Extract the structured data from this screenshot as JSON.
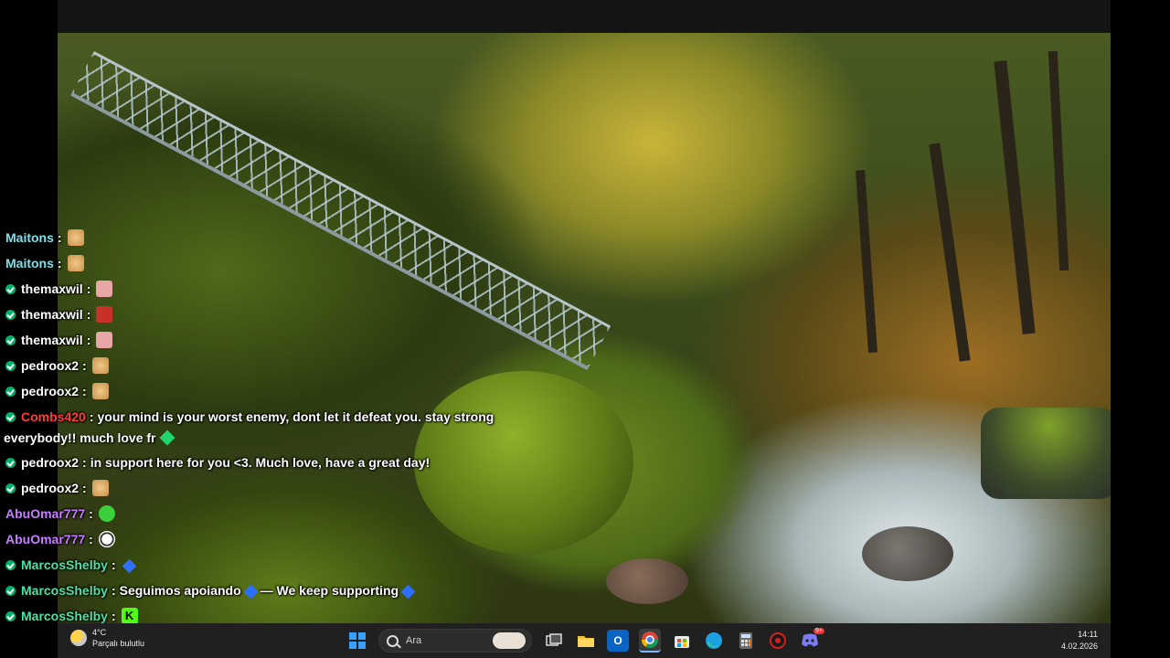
{
  "chat": [
    {
      "user": "Maitons",
      "user_color": "#7fe0e6",
      "badge": false,
      "emote": "clap-icon"
    },
    {
      "user": "Maitons",
      "user_color": "#7fe0e6",
      "badge": false,
      "emote": "clap-icon"
    },
    {
      "user": "themaxwil",
      "user_color": "#ffffff",
      "badge": true,
      "emote": "pink-face-icon"
    },
    {
      "user": "themaxwil",
      "user_color": "#ffffff",
      "badge": true,
      "emote": "red-face-icon"
    },
    {
      "user": "themaxwil",
      "user_color": "#ffffff",
      "badge": true,
      "emote": "pink-face-icon"
    },
    {
      "user": "pedroox2",
      "user_color": "#ffffff",
      "badge": true,
      "emote": "clap-icon"
    },
    {
      "user": "pedroox2",
      "user_color": "#ffffff",
      "badge": true,
      "emote": "clap-icon"
    },
    {
      "user": "Combs420",
      "user_color": "#ff3b3b",
      "badge": true,
      "text": "your mind is your worst enemy, dont let it defeat you. stay strong",
      "text2": "everybody!! much love fr"
    },
    {
      "user": "pedroox2",
      "user_color": "#ffffff",
      "badge": true,
      "text": "in support here for you <3. Much love, have a great day!"
    },
    {
      "user": "pedroox2",
      "user_color": "#ffffff",
      "badge": true,
      "emote": "clap-icon"
    },
    {
      "user": "AbuOmar777",
      "user_color": "#c77dff",
      "badge": false,
      "emote": "green-blob-icon"
    },
    {
      "user": "AbuOmar777",
      "user_color": "#c77dff",
      "badge": false,
      "emote": "soccer-ball-icon"
    },
    {
      "user": "MarcosShelby",
      "user_color": "#4fe0a6",
      "badge": true,
      "emote": "blue-heart-icon"
    },
    {
      "user": "MarcosShelby",
      "user_color": "#4fe0a6",
      "badge": true,
      "text": "Seguimos apoiando",
      "text_b": "— We keep supporting"
    },
    {
      "user": "MarcosShelby",
      "user_color": "#4fe0a6",
      "badge": true,
      "emote": "kick-logo-icon"
    }
  ],
  "separator": ":",
  "taskbar": {
    "weather_temp": "4°C",
    "weather_desc": "Parçalı bulutlu",
    "search_placeholder": "Ara",
    "time": "14:11",
    "date": "4.02.2026",
    "discord_badge": "9+",
    "apps": [
      "windows-start-icon",
      "task-view-icon",
      "file-explorer-icon",
      "outlook-icon",
      "chrome-icon",
      "ms-store-icon",
      "edge-icon",
      "calculator-icon",
      "red-app-icon",
      "discord-icon"
    ]
  }
}
